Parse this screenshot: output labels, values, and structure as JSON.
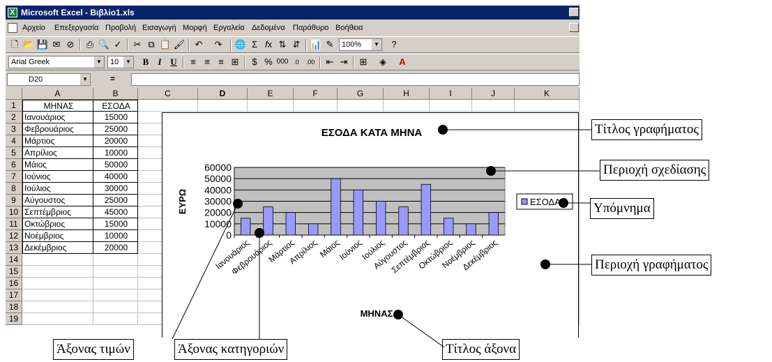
{
  "window": {
    "title": "Microsoft Excel - Βιβλίο1.xls"
  },
  "menu": [
    "Αρχείο",
    "Επεξεργασία",
    "Προβολή",
    "Εισαγωγή",
    "Μορφή",
    "Εργαλεία",
    "Δεδομένα",
    "Παράθυρο",
    "Βοήθεια"
  ],
  "toolbar": {
    "zoom": "100%"
  },
  "format": {
    "font": "Arial Greek",
    "size": "10"
  },
  "formula": {
    "name_box": "D20",
    "eq": "="
  },
  "columns": [
    "A",
    "B",
    "C",
    "D",
    "E",
    "F",
    "G",
    "H",
    "I",
    "J",
    "K"
  ],
  "rows": [
    "1",
    "2",
    "3",
    "4",
    "5",
    "6",
    "7",
    "8",
    "9",
    "10",
    "11",
    "12",
    "13",
    "14",
    "15",
    "16",
    "17",
    "18",
    "19"
  ],
  "sheet": {
    "header": [
      "ΜΗΝΑΣ",
      "ΕΣΟΔΑ"
    ],
    "data": [
      [
        "Ιανουάριος",
        "15000"
      ],
      [
        "Φεβρουάριος",
        "25000"
      ],
      [
        "Μάρτιος",
        "20000"
      ],
      [
        "Απρίλιος",
        "10000"
      ],
      [
        "Μάιος",
        "50000"
      ],
      [
        "Ιούνιος",
        "40000"
      ],
      [
        "Ιούλιος",
        "30000"
      ],
      [
        "Αύγουστος",
        "25000"
      ],
      [
        "Σεπτέμβριος",
        "45000"
      ],
      [
        "Οκτώβριος",
        "15000"
      ],
      [
        "Νοέμβριος",
        "10000"
      ],
      [
        "Δεκέμβριος",
        "20000"
      ]
    ]
  },
  "chart_data": {
    "type": "bar",
    "title": "ΕΣΟΔΑ ΚΑΤΑ ΜΗΝΑ",
    "xlabel": "ΜΗΝΑΣ",
    "ylabel": "ΕΥΡΩ",
    "categories": [
      "Ιανουάριος",
      "Φεβρουάριος",
      "Μάρτιος",
      "Απρίλιος",
      "Μάιος",
      "Ιούνιος",
      "Ιούλιος",
      "Αύγουστος",
      "Σεπτέμβριος",
      "Οκτώβριος",
      "Νοέμβριος",
      "Δεκέμβριος"
    ],
    "series": [
      {
        "name": "ΕΣΟΔΑ",
        "values": [
          15000,
          25000,
          20000,
          10000,
          50000,
          40000,
          30000,
          25000,
          45000,
          15000,
          10000,
          20000
        ]
      }
    ],
    "yticks": [
      "0",
      "10000",
      "20000",
      "30000",
      "40000",
      "50000",
      "60000"
    ],
    "ylim": [
      0,
      60000
    ],
    "grid": true,
    "legend": "right",
    "bar_color": "#9999ff",
    "plot_bg": "#c0c0c0"
  },
  "annotations": {
    "chart_title": "Τίτλος γραφήματος",
    "plot_area": "Περιοχή σχεδίασης",
    "legend": "Υπόμνημα",
    "chart_area": "Περιοχή γραφήματος",
    "value_axis": "Άξονας τιμών",
    "category_axis": "Άξονας κατηγοριών",
    "axis_title": "Τίτλος άξονα"
  }
}
